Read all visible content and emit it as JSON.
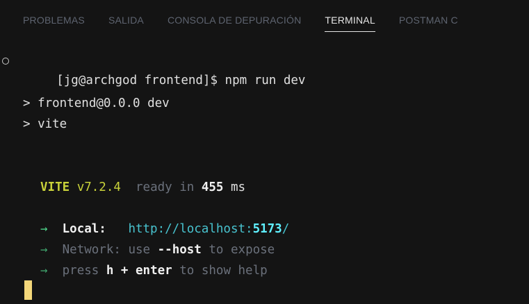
{
  "tabs": [
    {
      "label": "PROBLEMAS",
      "active": false
    },
    {
      "label": "SALIDA",
      "active": false
    },
    {
      "label": "CONSOLA DE DEPURACIÓN",
      "active": false
    },
    {
      "label": "TERMINAL",
      "active": true
    },
    {
      "label": "POSTMAN C",
      "active": false
    }
  ],
  "terminal": {
    "prompt": "[jg@archgod frontend]$ npm run dev",
    "script_line1": "> frontend@0.0.0 dev",
    "script_line2": "> vite",
    "vite_name": "VITE",
    "vite_version": "v7.2.4",
    "ready_text": "ready in",
    "ready_ms": "455",
    "ms_unit": "ms",
    "arrow": "→",
    "local_label": "Local:",
    "local_url_prefix": "http://localhost:",
    "local_port": "5173",
    "local_url_suffix": "/",
    "network_label": "Network:",
    "network_use": "use",
    "network_flag": "--host",
    "network_tail": "to expose",
    "help_press": "press",
    "help_keys": "h + enter",
    "help_tail": "to show help"
  },
  "colors": {
    "background": "#141414",
    "vite": "#c9d23a",
    "arrow": "#4ed38a",
    "url": "#48c3cf",
    "cursor": "#f4d77a"
  }
}
